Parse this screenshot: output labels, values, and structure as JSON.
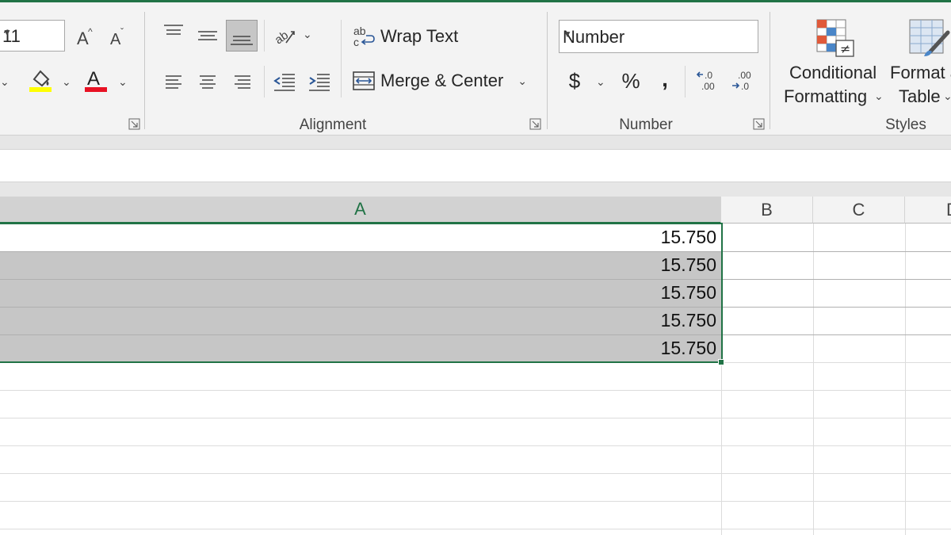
{
  "ribbon": {
    "font": {
      "size": "11",
      "increase_icon": "increase-font-size-icon",
      "decrease_icon": "decrease-font-size-icon",
      "fill_color": "#ffff00",
      "font_color": "#e81123"
    },
    "alignment": {
      "label": "Alignment",
      "wrap_text": "Wrap Text",
      "merge_center": "Merge & Center",
      "active_button": "align-bottom"
    },
    "number": {
      "label": "Number",
      "format_value": "Number",
      "currency_symbol": "$",
      "percent_symbol": "%",
      "comma_symbol": ",",
      "increase_decimal": ".0\n.00",
      "decrease_decimal": ".00\n.0"
    },
    "styles": {
      "label": "Styles",
      "conditional_line1": "Conditional",
      "conditional_line2": "Formatting",
      "format_table_line1": "Format a",
      "format_table_line2": "Table"
    }
  },
  "grid": {
    "columns": [
      "A",
      "B",
      "C",
      "D"
    ],
    "selected_column": "A",
    "cells_A": [
      "15.750",
      "15.750",
      "15.750",
      "15.750",
      "15.750"
    ],
    "accent": "#217346"
  }
}
